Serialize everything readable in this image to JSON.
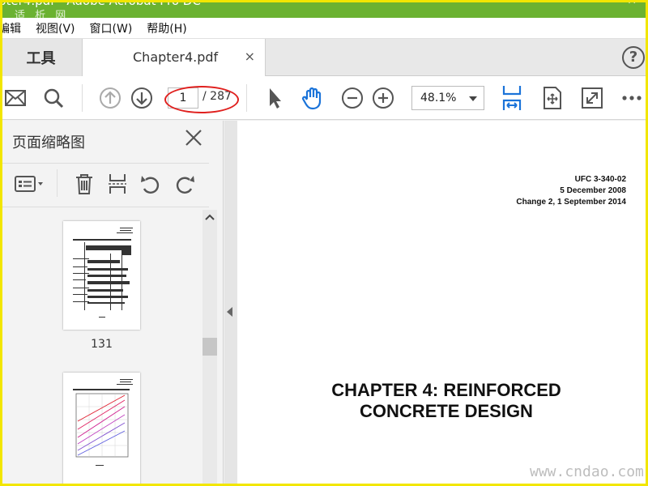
{
  "window": {
    "title": "pter4.pdf - Adobe Acrobat Pro DC",
    "close_glyph": "✕",
    "watermark_top": "适 析 网",
    "watermark_bottom": "www.cndao.com"
  },
  "menu": [
    "编辑",
    "视图(V)",
    "窗口(W)",
    "帮助(H)"
  ],
  "tabs": {
    "tools_label": "工具",
    "doc_name": "Chapter4.pdf",
    "close_glyph": "×",
    "help_glyph": "?"
  },
  "toolbar": {
    "page_current": "1",
    "page_total": "/ 287",
    "zoom": "48.1%",
    "icons": [
      "mail-icon",
      "search-icon",
      "prev-page-icon",
      "next-page-icon",
      "select-arrow-icon",
      "hand-icon",
      "zoom-out-icon",
      "zoom-in-icon",
      "fit-width-icon",
      "page-fit-icon",
      "fullscreen-icon",
      "more-icon"
    ],
    "accent": "#1a73d9",
    "annotation_color": "#e0201e"
  },
  "sidebar": {
    "title": "页面缩略图",
    "close_glyph": "×",
    "thumbnails": [
      {
        "label": "131"
      },
      {
        "label": ""
      }
    ]
  },
  "document": {
    "header_lines": [
      "UFC 3-340-02",
      "5 December 2008",
      "Change 2, 1 September 2014"
    ],
    "chapter_lines": [
      "CHAPTER 4: REINFORCED",
      "CONCRETE DESIGN"
    ]
  }
}
